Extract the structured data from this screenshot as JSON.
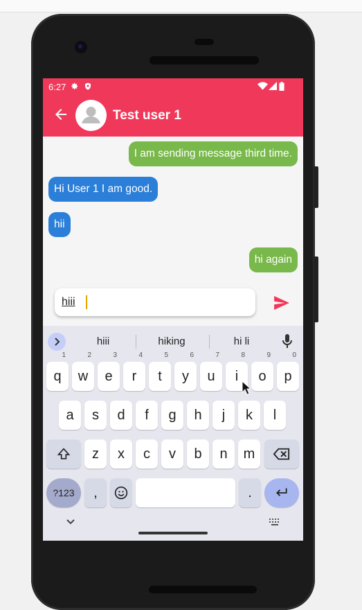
{
  "status_bar": {
    "time": "6:27",
    "icons": [
      "gear-icon",
      "shield-icon",
      "wifi-icon",
      "signal-icon",
      "battery-icon"
    ]
  },
  "app_bar": {
    "title": "Test user 1",
    "back_icon": "arrow-left-icon",
    "avatar_icon": "person-icon",
    "color": "#f0395a"
  },
  "messages": [
    {
      "text": "I am sending message third time.",
      "side": "right",
      "color": "#79b84a"
    },
    {
      "text": "Hi User 1 I am good.",
      "side": "left",
      "color": "#2b7fd8"
    },
    {
      "text": "hii",
      "side": "left",
      "color": "#2b7fd8"
    },
    {
      "text": "hi again",
      "side": "right",
      "color": "#79b84a"
    }
  ],
  "composer": {
    "value": "hiii",
    "send_icon": "send-icon"
  },
  "keyboard": {
    "suggestions": [
      "hiii",
      "hiking",
      "hi li"
    ],
    "row1": [
      "q",
      "w",
      "e",
      "r",
      "t",
      "y",
      "u",
      "i",
      "o",
      "p"
    ],
    "row1_hints": [
      "1",
      "2",
      "3",
      "4",
      "5",
      "6",
      "7",
      "8",
      "9",
      "0"
    ],
    "row2": [
      "a",
      "s",
      "d",
      "f",
      "g",
      "h",
      "j",
      "k",
      "l"
    ],
    "row3": [
      "z",
      "x",
      "c",
      "v",
      "b",
      "n",
      "m"
    ],
    "symbols_label": "?123",
    "comma_label": ",",
    "period_label": "."
  }
}
